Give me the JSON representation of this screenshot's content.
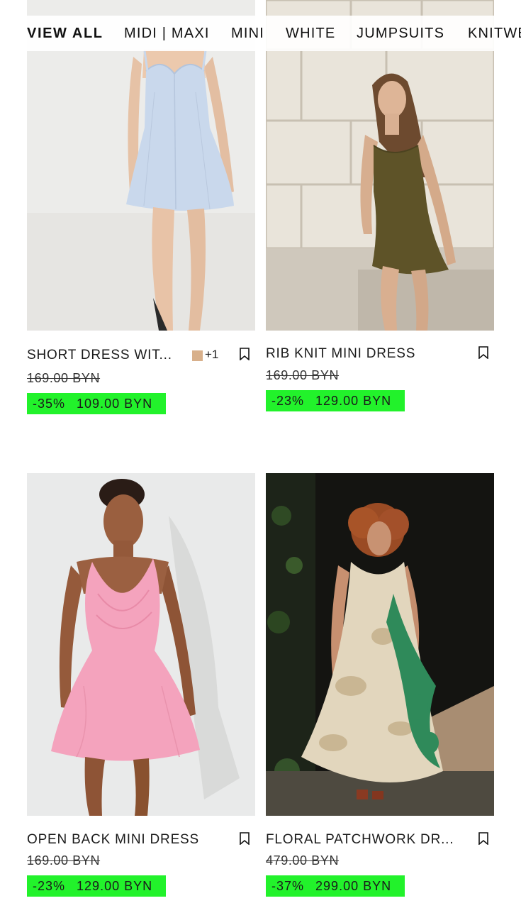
{
  "tabs": [
    {
      "label": "VIEW ALL",
      "active": true
    },
    {
      "label": "MIDI | MAXI"
    },
    {
      "label": "MINI"
    },
    {
      "label": "WHITE"
    },
    {
      "label": "JUMPSUITS"
    },
    {
      "label": "KNITWE"
    }
  ],
  "products": [
    {
      "name": "SHORT DRESS WIT...",
      "more_colors": "+1",
      "swatch_color": "#d8b08b",
      "old_price": "169.00 BYN",
      "discount": "-35%",
      "price": "109.00 BYN",
      "bookmark_icon": "bookmark-icon"
    },
    {
      "name": "RIB KNIT MINI DRESS",
      "old_price": "169.00 BYN",
      "discount": "-23%",
      "price": "129.00 BYN",
      "bookmark_icon": "bookmark-icon"
    },
    {
      "name": "OPEN BACK MINI DRESS",
      "old_price": "169.00 BYN",
      "discount": "-23%",
      "price": "129.00 BYN",
      "bookmark_icon": "bookmark-icon"
    },
    {
      "name": "FLORAL PATCHWORK DR...",
      "old_price": "479.00 BYN",
      "discount": "-37%",
      "price": "299.00 BYN",
      "bookmark_icon": "bookmark-icon"
    }
  ],
  "colors": {
    "discount_highlight": "#22f22b",
    "text": "#111111"
  }
}
